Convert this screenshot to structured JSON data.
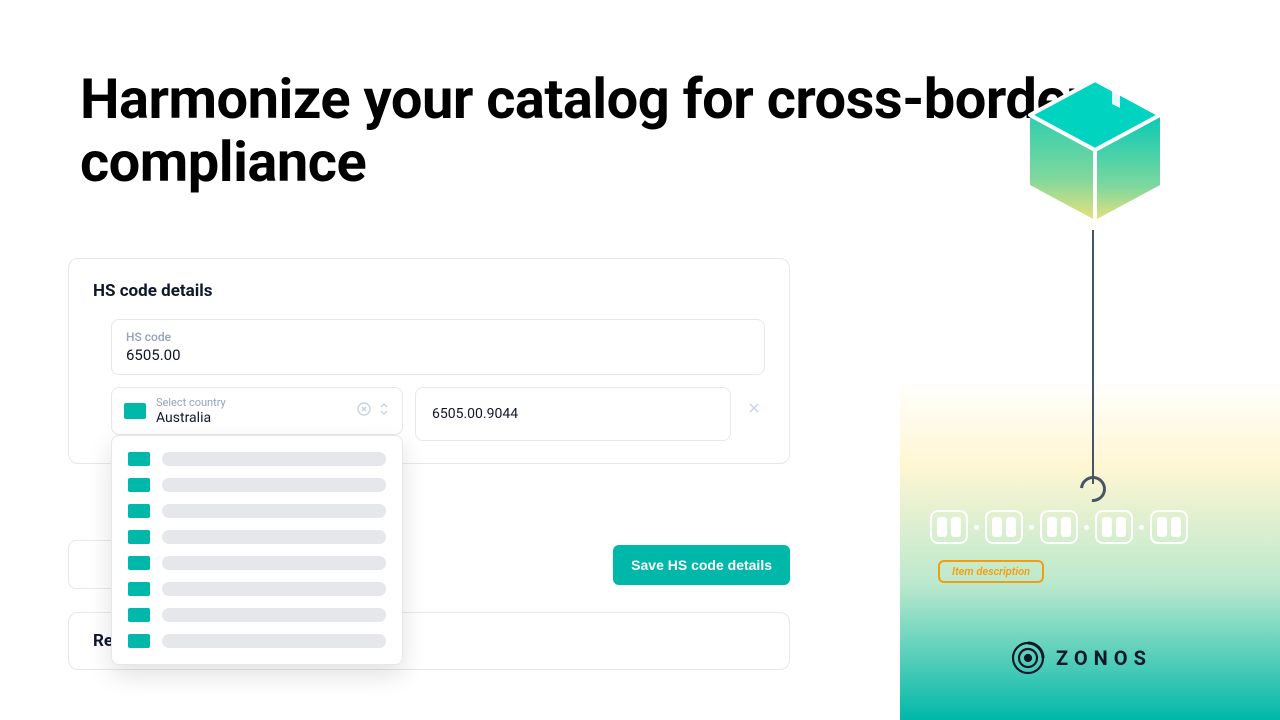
{
  "heading": "Harmonize your catalog for cross-border compliance",
  "card": {
    "title": "HS code details",
    "hs_label": "HS code",
    "hs_value": "6505.00",
    "country_label": "Select country",
    "country_value": "Australia",
    "code_value": "6505.00.9044",
    "save_button": "Save HS code details"
  },
  "card2": {
    "prefix": "Re"
  },
  "right": {
    "desc_label": "Item description",
    "brand": "ZONOS"
  },
  "colors": {
    "accent": "#00b8a9",
    "badge": "#f59e0b"
  }
}
